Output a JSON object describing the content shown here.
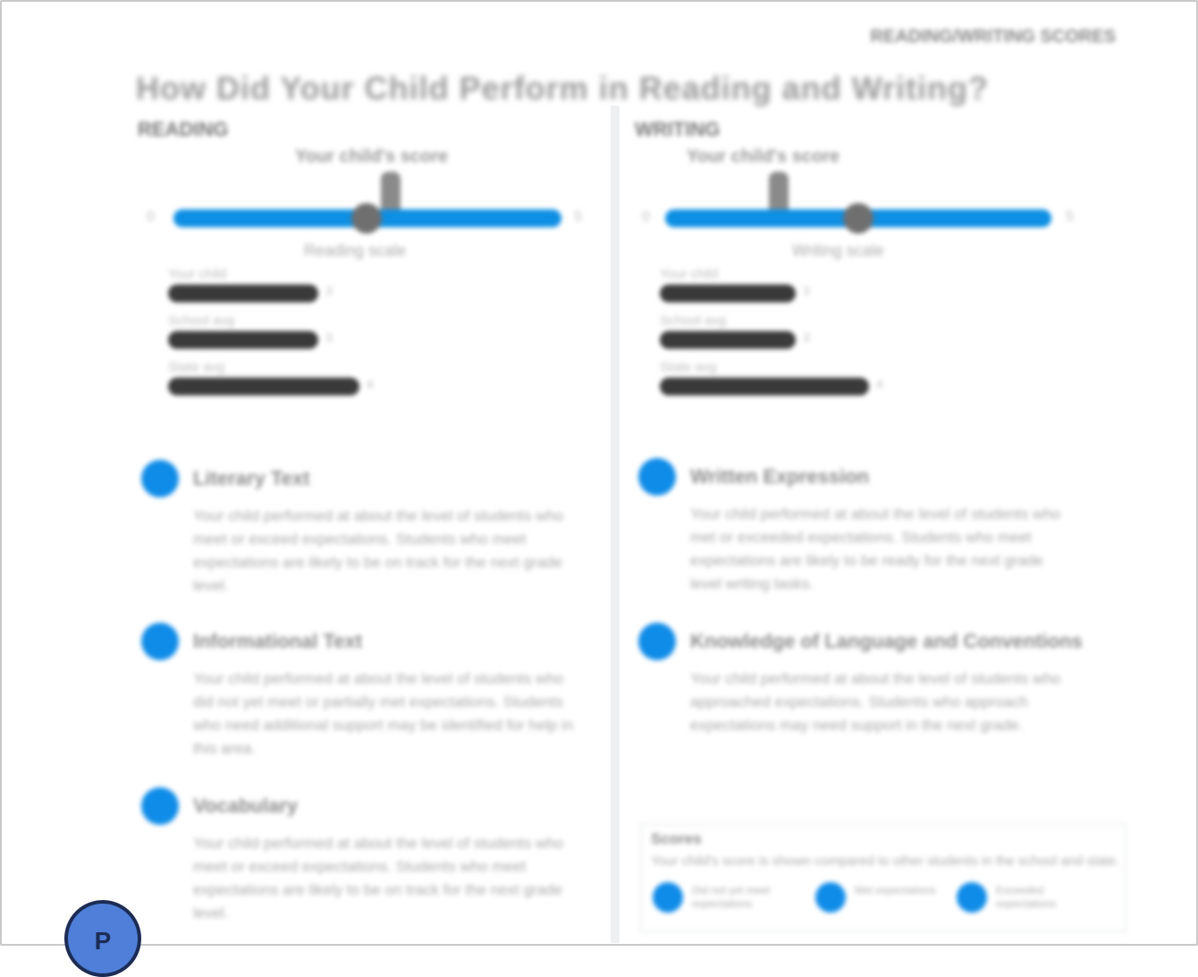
{
  "header": {
    "meta": "READING/WRITING SCORES"
  },
  "title": "How Did Your Child Perform in Reading and Writing?",
  "columns": [
    {
      "name": "READING",
      "score_caption": "Your child's score",
      "scale_min_label": "0",
      "scale_max_label": "5",
      "scale_caption": "Reading scale",
      "score_fraction": 0.5,
      "bars": [
        {
          "label": "Your child",
          "fraction": 0.78,
          "end_label": "3"
        },
        {
          "label": "School avg",
          "fraction": 0.78,
          "end_label": "3"
        },
        {
          "label": "State avg",
          "fraction": 1.0,
          "end_label": "4"
        }
      ],
      "bullets": [
        {
          "title": "Literary Text",
          "text": "Your child performed at about the level of students who meet or exceed expectations. Students who meet expectations are likely to be on track for the next grade level."
        },
        {
          "title": "Informational Text",
          "text": "Your child performed at about the level of students who did not yet meet or partially met expectations. Students who need additional support may be identified for help in this area."
        },
        {
          "title": "Vocabulary",
          "text": "Your child performed at about the level of students who meet or exceed expectations. Students who meet expectations are likely to be on track for the next grade level."
        }
      ]
    },
    {
      "name": "WRITING",
      "score_caption": "Your child's score",
      "scale_min_label": "0",
      "scale_max_label": "5",
      "scale_caption": "Writing scale",
      "score_fraction": 0.5,
      "bars": [
        {
          "label": "Your child",
          "fraction": 0.7,
          "end_label": "3"
        },
        {
          "label": "School avg",
          "fraction": 0.7,
          "end_label": "3"
        },
        {
          "label": "State avg",
          "fraction": 1.0,
          "end_label": "4"
        }
      ],
      "bullets": [
        {
          "title": "Written Expression",
          "text": "Your child performed at about the level of students who met or exceeded expectations. Students who meet expectations are likely to be ready for the next grade level writing tasks."
        },
        {
          "title": "Knowledge of Language and Conventions",
          "text": "Your child performed at about the level of students who approached expectations. Students who approach expectations may need support in the next grade."
        }
      ],
      "key": {
        "title": "Scores",
        "description": "Your child's score is shown compared to other students in the school and state.",
        "items": [
          {
            "label": "Did not yet meet expectations"
          },
          {
            "label": "Met expectations"
          },
          {
            "label": "Exceeded expectations"
          }
        ]
      }
    }
  ],
  "badge": {
    "letter": "P"
  },
  "colors": {
    "accent": "#0f8ce8",
    "bar": "#3a3a3a",
    "thumb": "#6f6f6f"
  }
}
